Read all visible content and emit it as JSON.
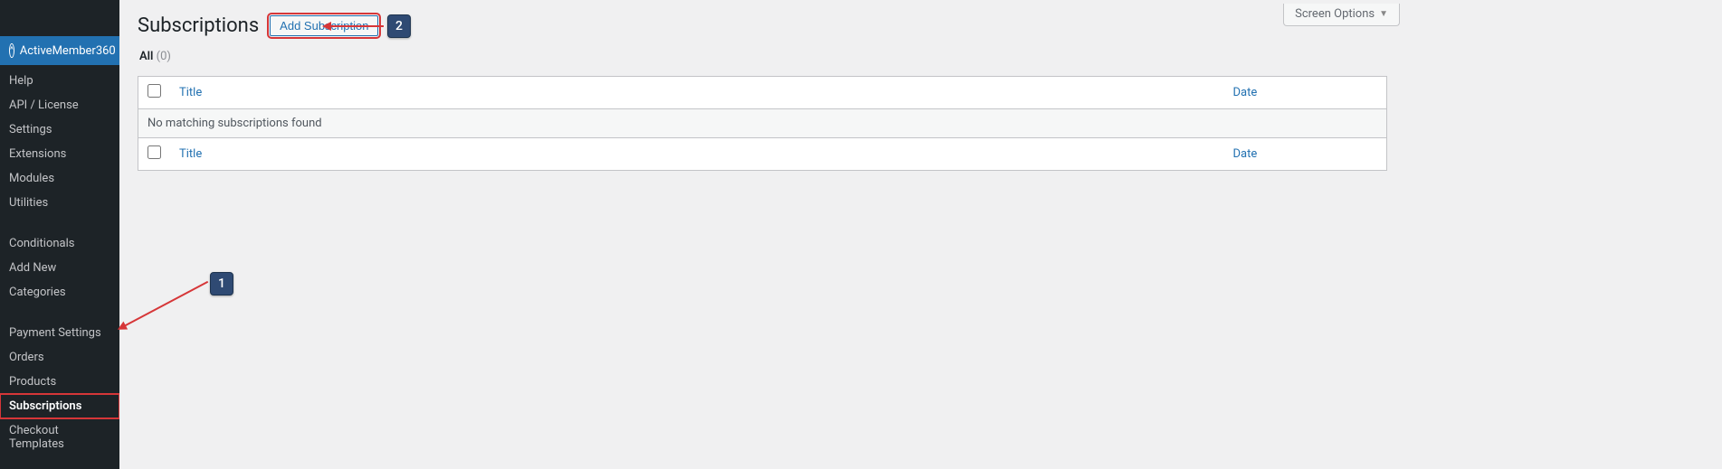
{
  "sidebar": {
    "plugin_label": "ActiveMember360",
    "items": [
      {
        "label": "Help"
      },
      {
        "label": "API / License"
      },
      {
        "label": "Settings"
      },
      {
        "label": "Extensions"
      },
      {
        "label": "Modules"
      },
      {
        "label": "Utilities"
      }
    ],
    "items2": [
      {
        "label": "Conditionals"
      },
      {
        "label": "Add New"
      },
      {
        "label": "Categories"
      }
    ],
    "items3": [
      {
        "label": "Payment Settings"
      },
      {
        "label": "Orders"
      },
      {
        "label": "Products"
      },
      {
        "label": "Subscriptions",
        "active": true
      },
      {
        "label": "Checkout Templates"
      }
    ]
  },
  "header": {
    "title": "Subscriptions",
    "add_label": "Add Subscription",
    "screen_options": "Screen Options"
  },
  "filter": {
    "all_label": "All",
    "all_count": "(0)"
  },
  "table": {
    "title_col": "Title",
    "date_col": "Date",
    "empty": "No matching subscriptions found"
  },
  "annotations": {
    "one": "1",
    "two": "2"
  }
}
